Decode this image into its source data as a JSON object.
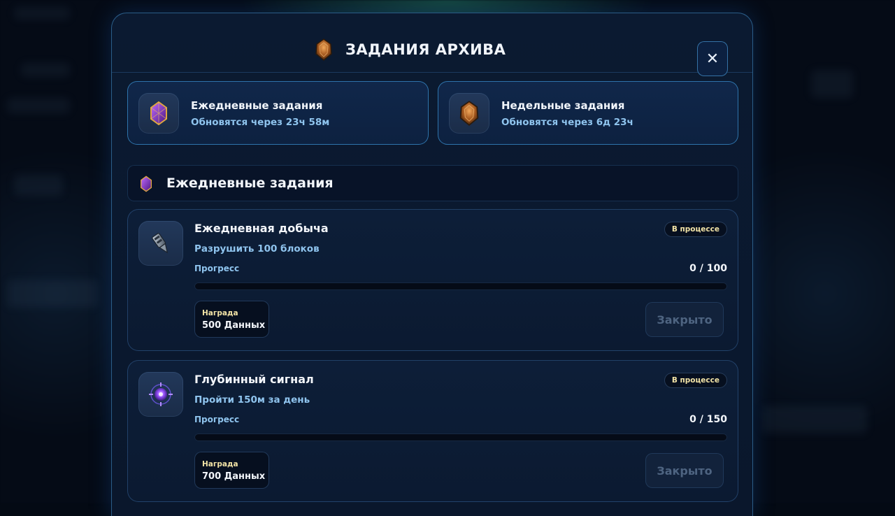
{
  "modal": {
    "title": "ЗАДАНИЯ АРХИВА",
    "title_icon": "amber-gem-icon",
    "close_label": "✕"
  },
  "tabs": [
    {
      "title": "Ежедневные задания",
      "subtitle": "Обновятся через 23ч 58м",
      "icon": "purple-crystal-icon"
    },
    {
      "title": "Недельные задания",
      "subtitle": "Обновятся через 6д 23ч",
      "icon": "amber-gem-icon"
    }
  ],
  "section": {
    "title": "Ежедневные задания",
    "icon": "purple-crystal-icon"
  },
  "quests": [
    {
      "name": "Ежедневная добыча",
      "description": "Разрушить 100 блоков",
      "status": "В процессе",
      "progress_label": "Прогресс",
      "progress_text": "0 / 100",
      "progress_fraction": 0,
      "reward_label": "Награда",
      "reward_value": "500 Данных",
      "claim_label": "Закрыто",
      "icon": "drill-icon"
    },
    {
      "name": "Глубинный сигнал",
      "description": "Пройти 150м за день",
      "status": "В процессе",
      "progress_label": "Прогресс",
      "progress_text": "0 / 150",
      "progress_fraction": 0,
      "reward_label": "Награда",
      "reward_value": "700 Данных",
      "claim_label": "Закрыто",
      "icon": "signal-orb-icon"
    }
  ],
  "colors": {
    "accent": "#8fc4ee",
    "badge_text": "#f2e3a6",
    "border": "#3c96d7",
    "panel": "#0b1a31"
  }
}
